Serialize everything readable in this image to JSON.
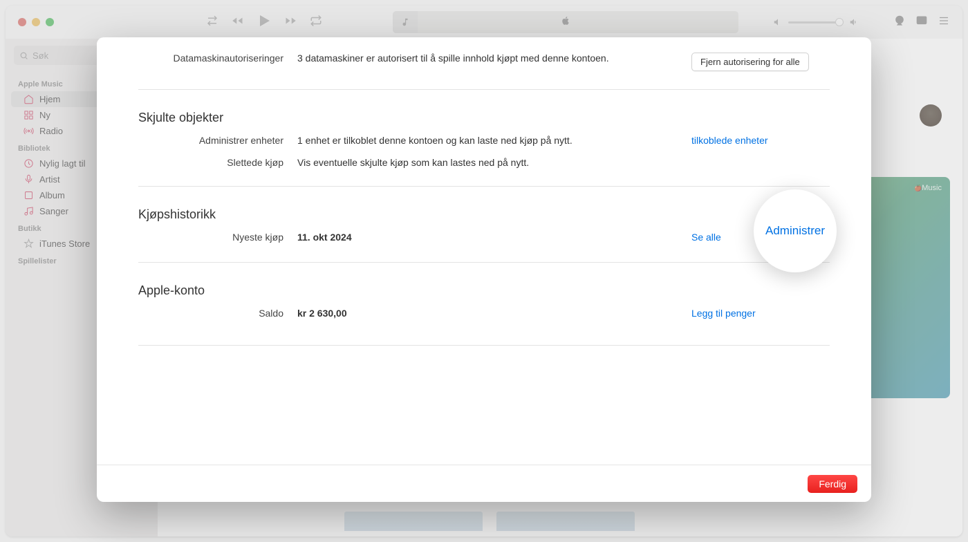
{
  "search": {
    "placeholder": "Søk"
  },
  "sidebar": {
    "sections": [
      {
        "title": "Apple Music",
        "items": [
          "Hjem",
          "Ny",
          "Radio"
        ]
      },
      {
        "title": "Bibliotek",
        "items": [
          "Nylig lagt til",
          "Artist",
          "Album",
          "Sanger"
        ]
      },
      {
        "title": "Butikk",
        "items": [
          "iTunes Store"
        ]
      },
      {
        "title": "Spillelister",
        "items": []
      }
    ]
  },
  "musicCard": {
    "brand": "Music"
  },
  "modal": {
    "authorization": {
      "label": "Datamaskinautoriseringer",
      "value": "3 datamaskiner er autorisert til å spille innhold kjøpt med denne kontoen.",
      "button": "Fjern autorisering for alle"
    },
    "hiddenSection": {
      "title": "Skjulte objekter",
      "devices": {
        "label": "Administrer enheter",
        "value": "1 enhet er tilkoblet denne kontoen og kan laste ned kjøp på nytt.",
        "link": "tilkoblede enheter"
      },
      "deleted": {
        "label": "Slettede kjøp",
        "value": "Vis eventuelle skjulte kjøp som kan lastes ned på nytt.",
        "link": "Administrer"
      }
    },
    "historySection": {
      "title": "Kjøpshistorikk",
      "latest": {
        "label": "Nyeste kjøp",
        "value": "11. okt 2024",
        "link": "Se alle"
      }
    },
    "accountSection": {
      "title": "Apple-konto",
      "balance": {
        "label": "Saldo",
        "value": "kr 2 630,00",
        "link": "Legg til penger"
      }
    },
    "footer": {
      "done": "Ferdig"
    }
  },
  "magnifier": {
    "text": "Administrer"
  }
}
